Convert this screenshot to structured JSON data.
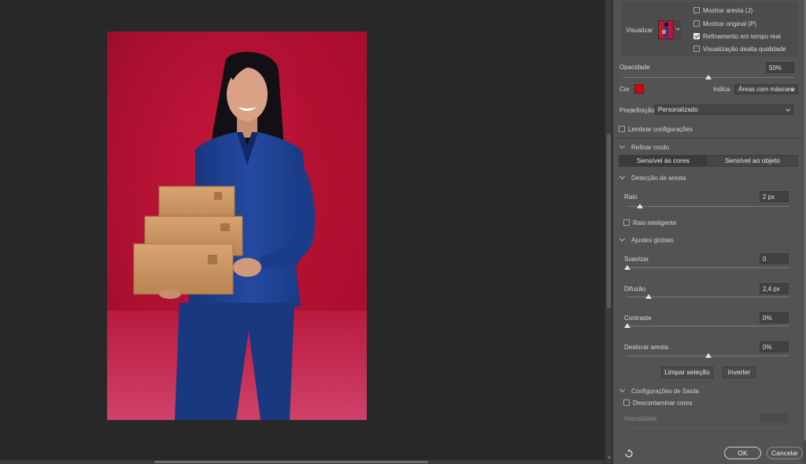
{
  "view": {
    "label": "Visualizar",
    "options": [
      {
        "label": "Mostrar aresta (J)",
        "checked": false
      },
      {
        "label": "Mostrar original (P)",
        "checked": false
      },
      {
        "label": "Refinamento em tempo real",
        "checked": true
      },
      {
        "label": "Visualização dealta qualidade",
        "checked": false
      }
    ]
  },
  "opacity": {
    "label": "Opacidade",
    "value": "50%",
    "level": 0.5
  },
  "color": {
    "label": "Cor",
    "swatch": "#e00000",
    "indicates_label": "Indica",
    "indicates_value": "Áreas com máscara"
  },
  "preset": {
    "label": "Predefinição",
    "value": "Personalizado"
  },
  "remember": {
    "label": "Lembrar configurações",
    "checked": false
  },
  "refine_mode": {
    "title": "Refinar modo",
    "options": [
      "Sensível às cores",
      "Sensível ao objeto"
    ],
    "selected": 0
  },
  "edge_detection": {
    "title": "Detecção de aresta",
    "radius_label": "Raio",
    "radius_value": "2 px",
    "radius_level": 0.08,
    "smart_radius_label": "Raio inteligente",
    "smart_radius_checked": false
  },
  "global": {
    "title": "Ajustes globais",
    "smooth_label": "Suavizar",
    "smooth_value": "0",
    "smooth_level": 0.0,
    "feather_label": "Difusão",
    "feather_value": "2,4 px",
    "feather_level": 0.13,
    "contrast_label": "Contraste",
    "contrast_value": "0%",
    "contrast_level": 0.0,
    "shift_label": "Deslocar aresta",
    "shift_value": "0%",
    "shift_level": 0.5,
    "clear_button": "Limpar seleção",
    "invert_button": "Inverter"
  },
  "output": {
    "title": "Configurações de Saída",
    "decontaminate_label": "Descontaminar cores",
    "decontaminate_checked": false,
    "amount_label": "Intensidade"
  },
  "footer": {
    "ok": "OK",
    "cancel": "Cancelar",
    "reset_icon": "reset-icon"
  },
  "colors": {
    "panel": "#535353",
    "canvas": "#282828",
    "photo_bg": "#c0143a",
    "suit": "#1d3f8a",
    "box": "#c9935f"
  }
}
